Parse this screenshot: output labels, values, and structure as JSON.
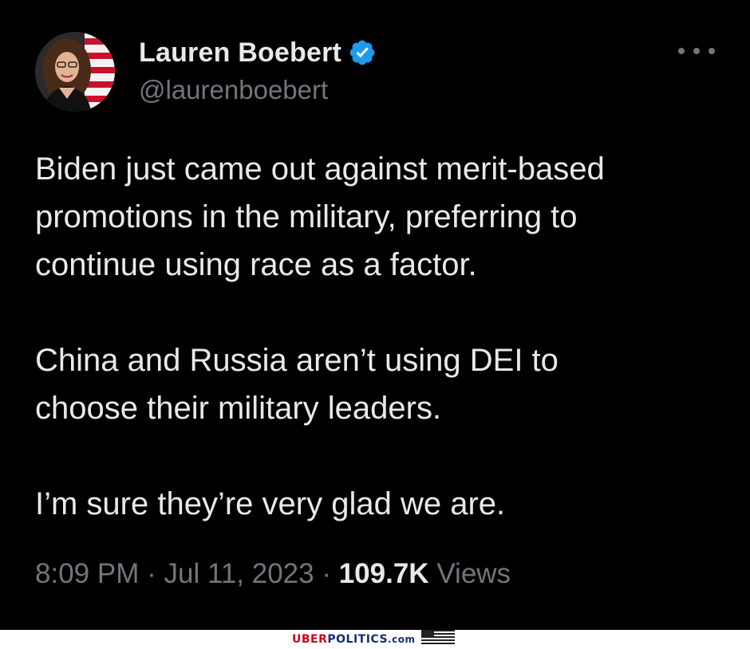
{
  "tweet": {
    "display_name": "Lauren Boebert",
    "handle": "@laurenboebert",
    "paragraphs": [
      "Biden just came out against merit-based\npromotions in the military, preferring to\ncontinue using race as a factor.",
      "China and Russia aren’t using DEI to\nchoose their military leaders.",
      "I’m sure they’re very glad we are."
    ],
    "time": "8:09 PM",
    "separator": "·",
    "date": "Jul 11, 2023",
    "views_count": "109.7K",
    "views_label": "Views",
    "verified_icon": "verified-badge-icon",
    "more_icon": "more-horizontal-icon"
  },
  "footer": {
    "brand_part1": "UBER",
    "brand_part2": "POLITICS",
    "brand_part3": ".com",
    "flag_icon": "us-flag-icon"
  },
  "colors": {
    "background": "#000000",
    "primary_text": "#e7e9ea",
    "secondary_text": "#71767b",
    "verified_blue": "#1d9bf0",
    "brand_red": "#d1001f",
    "brand_blue": "#1a2d6b"
  }
}
